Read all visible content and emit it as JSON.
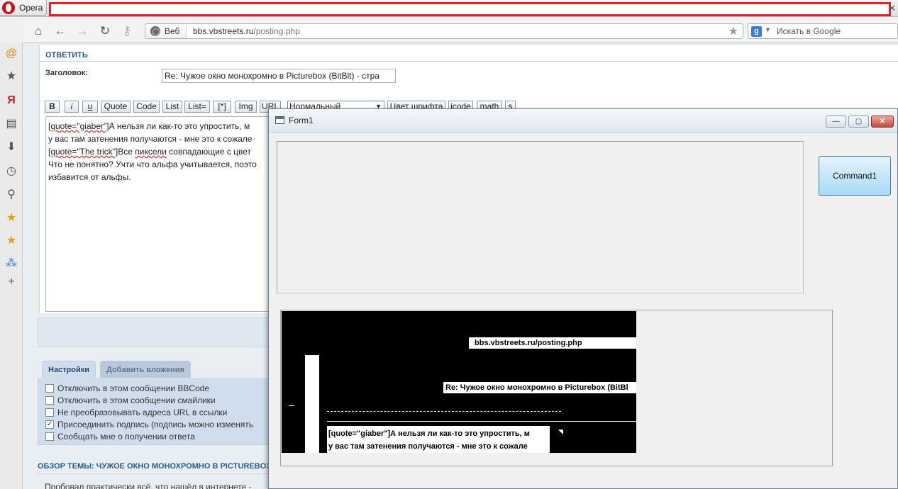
{
  "browser": {
    "app_label": "Opera",
    "web_label": "Веб",
    "url_host": "bbs.vbstreets.ru",
    "url_path": "/posting.php",
    "search_placeholder": "Искать в Google"
  },
  "reply": {
    "heading": "ОТВЕТИТЬ",
    "title_label": "Заголовок:",
    "title_value": "Re: Чужое окно монохромно в Picturebox (BitBlt) - стра",
    "toolbar": {
      "b": "B",
      "i": "i",
      "u": "u",
      "quote": "Quote",
      "code": "Code",
      "list": "List",
      "list_eq": "List=",
      "star": "[*]",
      "img": "Img",
      "url": "URL",
      "size_select": "Нормальный",
      "color": "Цвет шрифта",
      "icode": "icode",
      "math": "math",
      "s": "s"
    },
    "editor_lines": {
      "l1_tag": "[quote=\"giaber\"]",
      "l1_text": "А нельзя ли как-то это упростить, м",
      "l2": "у вас там затенения получаются - мне это к сожале",
      "l3_tag": "[quote=\"The trick\"]",
      "l3_text": "Все ",
      "l3_spell": "пиксели",
      "l3_rest": " совпадающие с цвет",
      "l4": "Что не понятно? Учти что альфа учитывается, поэто",
      "l5": "избавится от альфы."
    }
  },
  "tabs": {
    "settings": "Настройки",
    "attachments": "Добавить вложения"
  },
  "options": [
    {
      "label": "Отключить в этом сообщении BBCode",
      "checked": ""
    },
    {
      "label": "Отключить в этом сообщении смайлики",
      "checked": ""
    },
    {
      "label": "Не преобразовывать адреса URL в ссылки",
      "checked": ""
    },
    {
      "label": "Присоединить подпись (подпись можно изменять",
      "checked": "✓"
    },
    {
      "label": "Сообщать мне о получении ответа",
      "checked": ""
    }
  ],
  "overview": {
    "heading": "ОБЗОР ТЕМЫ: ЧУЖОЕ ОКНО МОНОХРОМНО В PICTUREBOX (",
    "text": "Пробовал практически всё, что нашёл в интернете -"
  },
  "form1": {
    "title": "Form1",
    "command_label": "Command1",
    "min_glyph": "—",
    "max_glyph": "▢",
    "close_glyph": "✕",
    "capture": {
      "url": "bbs.vbstreets.ru/posting.php",
      "title": "Re: Чужое окно монохромно в Picturebox (BitBl",
      "line1": "[quote=\"giaber\"]А нельзя ли как-то это упростить, м",
      "line2": "у вас там затенения получаются - мне это к сожале"
    }
  },
  "icons": {
    "home": "home-icon",
    "back": "back-icon",
    "forward": "forward-icon",
    "reload": "reload-icon",
    "key": "key-icon",
    "bookmark_star": "bookmark-star-icon"
  },
  "colors": {
    "opera_red": "#cc0f16",
    "highlight_box": "#e2232a",
    "link_blue": "#2a5b8c",
    "command_button": "#a7d9f5"
  }
}
